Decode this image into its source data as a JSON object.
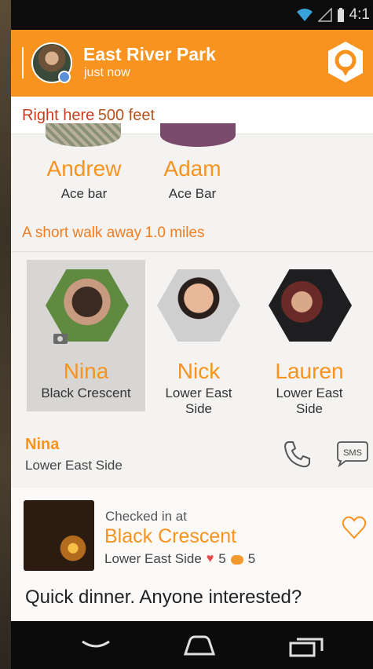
{
  "status": {
    "time": "4:1"
  },
  "header": {
    "title": "East River Park",
    "subtitle": "just now"
  },
  "right_here": {
    "label": "Right here",
    "distance": "500 feet"
  },
  "row1": [
    {
      "name": "Andrew",
      "place": "Ace bar"
    },
    {
      "name": "Adam",
      "place": "Ace Bar"
    }
  ],
  "short_walk": {
    "label": "A short walk away",
    "distance": "1.0 miles"
  },
  "row2": [
    {
      "name": "Nina",
      "place": "Black Crescent",
      "selected": true
    },
    {
      "name": "Nick",
      "place_l1": "Lower East",
      "place_l2": "Side"
    },
    {
      "name": "Lauren",
      "place_l1": "Lower East",
      "place_l2": "Side"
    }
  ],
  "detail": {
    "name": "Nina",
    "place": "Lower East Side",
    "sms_label": "SMS"
  },
  "checkin": {
    "label": "Checked in at",
    "venue": "Black Crescent",
    "place": "Lower East Side",
    "likes": "5",
    "comments": "5",
    "message": "Quick dinner. Anyone interested?"
  },
  "colors": {
    "accent": "#f7931e",
    "distance_red": "#d03a1f",
    "like": "#e64a4a"
  },
  "icons": [
    "wifi-icon",
    "signal-icon",
    "battery-icon",
    "app-logo-icon",
    "camera-icon",
    "phone-call-icon",
    "sms-icon",
    "heart-icon",
    "comment-icon",
    "back-icon",
    "home-icon",
    "recents-icon"
  ]
}
